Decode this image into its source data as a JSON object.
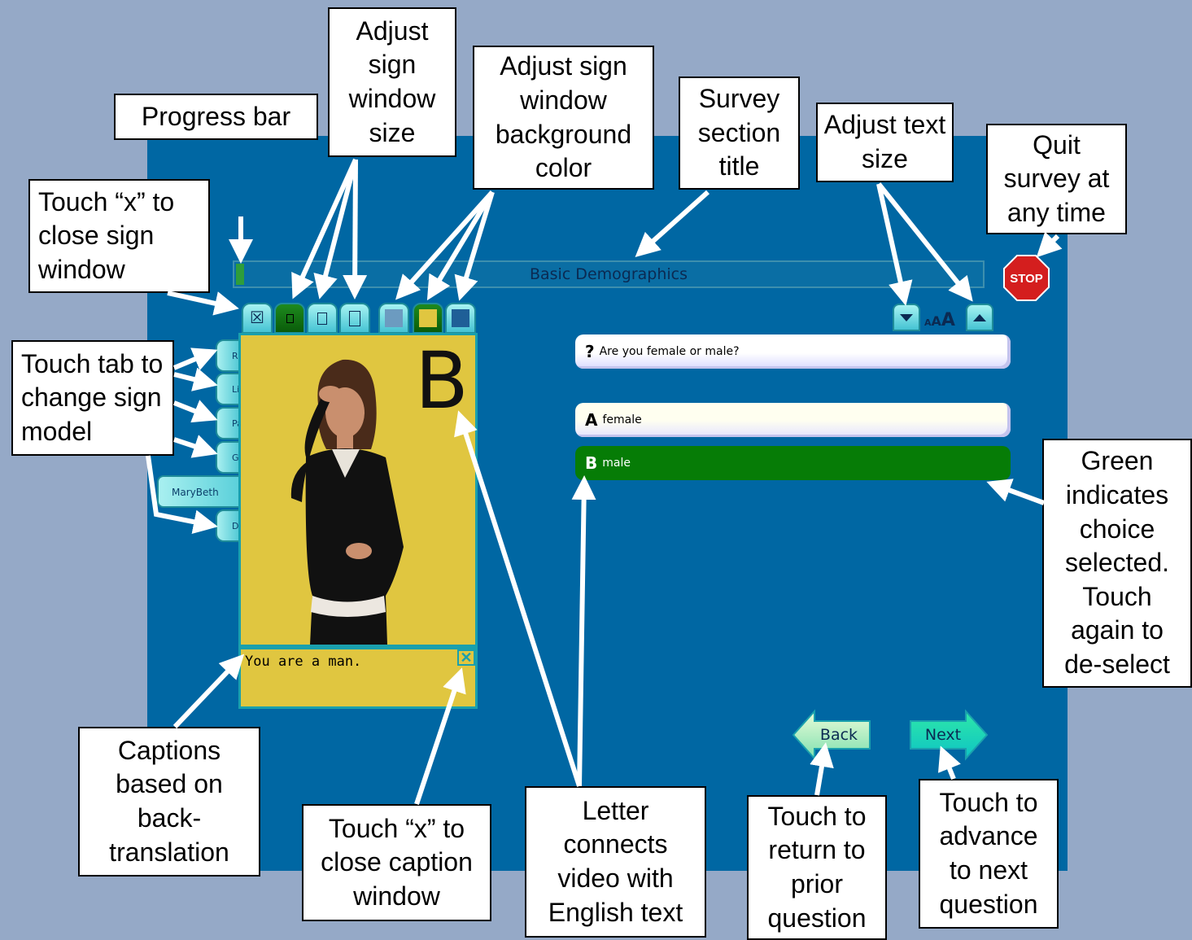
{
  "app": {
    "section_title": "Basic Demographics",
    "progress_fraction": 0.01,
    "stop_label": "STOP",
    "caption_text": "You are a man.",
    "video_letter": "B",
    "model_tabs": [
      "R",
      "Li",
      "Pa",
      "G",
      "D"
    ],
    "model_tab_selected": "MaryBeth",
    "question": {
      "marker": "?",
      "text": "Are you female or male?"
    },
    "choices": [
      {
        "letter": "A",
        "text": "female",
        "selected": false
      },
      {
        "letter": "B",
        "text": "male",
        "selected": true
      }
    ],
    "text_size_label": {
      "small": "A",
      "mid": "A",
      "large": "A"
    },
    "back_label": "Back",
    "next_label": "Next",
    "swatch_colors": [
      "#6c9bc0",
      "#e0c640",
      "#1f5f97"
    ],
    "colors": {
      "background": "#95a9c7",
      "app": "#0067a3",
      "selected": "#067c06",
      "video": "#e0c640"
    }
  },
  "callouts": {
    "progress_bar": "Progress bar",
    "adjust_size": "Adjust sign window size",
    "adjust_bg": "Adjust sign window background color",
    "section_title": "Survey section title",
    "adjust_text": "Adjust text size",
    "quit": "Quit survey at any time",
    "close_sign": "Touch “x” to close sign window",
    "change_model": "Touch tab to change sign model",
    "green": "Green indicates choice selected. Touch again to de-select",
    "captions": "Captions based on back-translation",
    "close_caption": "Touch “x” to close caption window",
    "letter": "Letter connects video with English text",
    "back_help": "Touch to return to prior question",
    "next_help": "Touch to advance to next question"
  }
}
